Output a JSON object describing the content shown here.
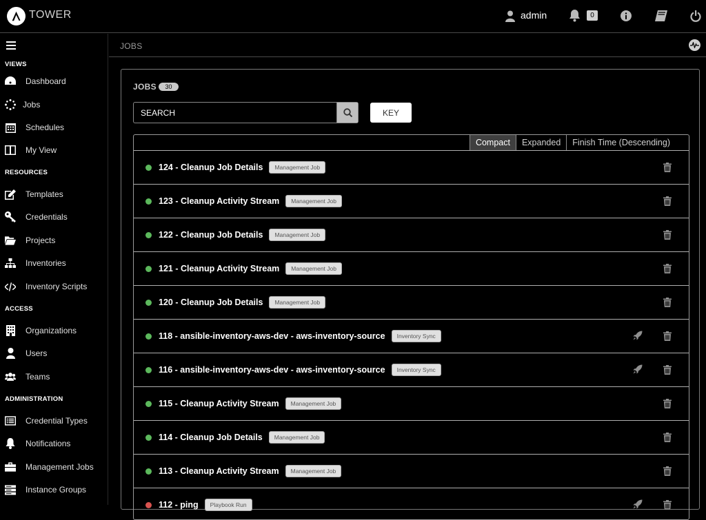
{
  "app": {
    "brand": "TOWER"
  },
  "header": {
    "user": "admin",
    "notification_count": "0"
  },
  "sidebar": {
    "sections": [
      {
        "title": "VIEWS",
        "items": [
          {
            "label": "Dashboard",
            "icon": "dashboard-icon"
          },
          {
            "label": "Jobs",
            "icon": "jobs-spinner-icon"
          },
          {
            "label": "Schedules",
            "icon": "calendar-icon"
          },
          {
            "label": "My View",
            "icon": "columns-icon"
          }
        ]
      },
      {
        "title": "RESOURCES",
        "items": [
          {
            "label": "Templates",
            "icon": "edit-icon"
          },
          {
            "label": "Credentials",
            "icon": "key-icon"
          },
          {
            "label": "Projects",
            "icon": "folder-icon"
          },
          {
            "label": "Inventories",
            "icon": "sitemap-icon"
          },
          {
            "label": "Inventory Scripts",
            "icon": "code-icon"
          }
        ]
      },
      {
        "title": "ACCESS",
        "items": [
          {
            "label": "Organizations",
            "icon": "building-icon"
          },
          {
            "label": "Users",
            "icon": "user-icon"
          },
          {
            "label": "Teams",
            "icon": "users-icon"
          }
        ]
      },
      {
        "title": "ADMINISTRATION",
        "items": [
          {
            "label": "Credential Types",
            "icon": "list-alt-icon"
          },
          {
            "label": "Notifications",
            "icon": "bell-icon"
          },
          {
            "label": "Management Jobs",
            "icon": "briefcase-icon"
          },
          {
            "label": "Instance Groups",
            "icon": "server-icon"
          }
        ]
      }
    ]
  },
  "breadcrumb": "JOBS",
  "panel": {
    "title": "JOBS",
    "count": "30",
    "search_placeholder": "SEARCH",
    "key_label": "KEY",
    "toggles": [
      "Compact",
      "Expanded",
      "Finish Time (Descending)"
    ],
    "active_toggle": "Compact"
  },
  "jobs": [
    {
      "name": "124 - Cleanup Job Details",
      "type": "Management Job",
      "status": "success",
      "relaunch": false
    },
    {
      "name": "123 - Cleanup Activity Stream",
      "type": "Management Job",
      "status": "success",
      "relaunch": false
    },
    {
      "name": "122 - Cleanup Job Details",
      "type": "Management Job",
      "status": "success",
      "relaunch": false
    },
    {
      "name": "121 - Cleanup Activity Stream",
      "type": "Management Job",
      "status": "success",
      "relaunch": false
    },
    {
      "name": "120 - Cleanup Job Details",
      "type": "Management Job",
      "status": "success",
      "relaunch": false
    },
    {
      "name": "118 - ansible-inventory-aws-dev - aws-inventory-source",
      "type": "Inventory Sync",
      "status": "success",
      "relaunch": true
    },
    {
      "name": "116 - ansible-inventory-aws-dev - aws-inventory-source",
      "type": "Inventory Sync",
      "status": "success",
      "relaunch": true
    },
    {
      "name": "115 - Cleanup Activity Stream",
      "type": "Management Job",
      "status": "success",
      "relaunch": false
    },
    {
      "name": "114 - Cleanup Job Details",
      "type": "Management Job",
      "status": "success",
      "relaunch": false
    },
    {
      "name": "113 - Cleanup Activity Stream",
      "type": "Management Job",
      "status": "success",
      "relaunch": false
    },
    {
      "name": "112 - ping",
      "type": "Playbook Run",
      "status": "failed",
      "relaunch": true
    }
  ],
  "colors": {
    "success": "#5cb85c",
    "failed": "#d9534f"
  }
}
